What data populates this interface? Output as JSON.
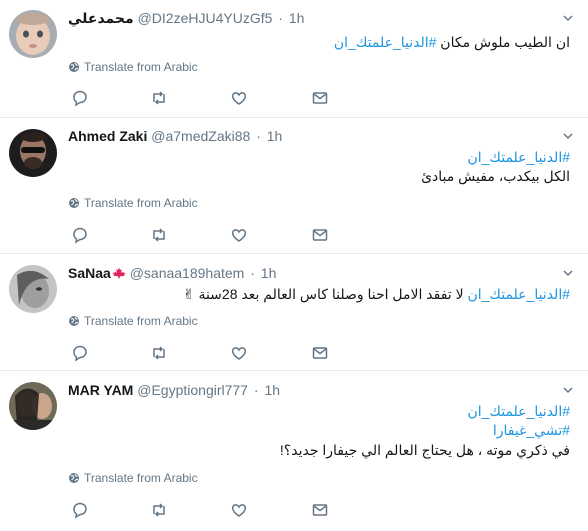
{
  "translate_label": "Translate from Arabic",
  "tweets": [
    {
      "name": "محمدعلي",
      "handle": "@DI2zeHJU4YUzGf5",
      "time": "1h",
      "lines": [
        {
          "text": "ان الطيب ملوش مكان ",
          "tag": "#الدنيا_علمتك_ان"
        }
      ]
    },
    {
      "name": "Ahmed Zaki",
      "handle": "@a7medZaki88",
      "time": "1h",
      "lines": [
        {
          "text": "",
          "tag": "#الدنيا_علمتك_ان"
        },
        {
          "text": "الكل بيكدب، مفيش مبادئ",
          "tag": ""
        }
      ]
    },
    {
      "name": "SaNaa",
      "handle": "@sanaa189hatem",
      "time": "1h",
      "lines": [
        {
          "text": " لا تفقد الامل احنا وصلنا كاس العالم بعد 28سنة ✌",
          "tag": "#الدنيا_علمتك_ان"
        }
      ]
    },
    {
      "name": "MAR YAM",
      "handle": "@Egyptiongirl777",
      "time": "1h",
      "lines": [
        {
          "text": "",
          "tag": "#الدنيا_علمتك_ان"
        },
        {
          "text": "",
          "tag": "#تشي_غيفارا"
        },
        {
          "text": "في ذكري موته ، هل يحتاج العالم الي جيفارا جديد؟!",
          "tag": ""
        }
      ]
    }
  ],
  "colors": {
    "text": "#14171a",
    "secondary": "#657786",
    "link": "#1b95e0",
    "divider": "#e6ecf0"
  }
}
